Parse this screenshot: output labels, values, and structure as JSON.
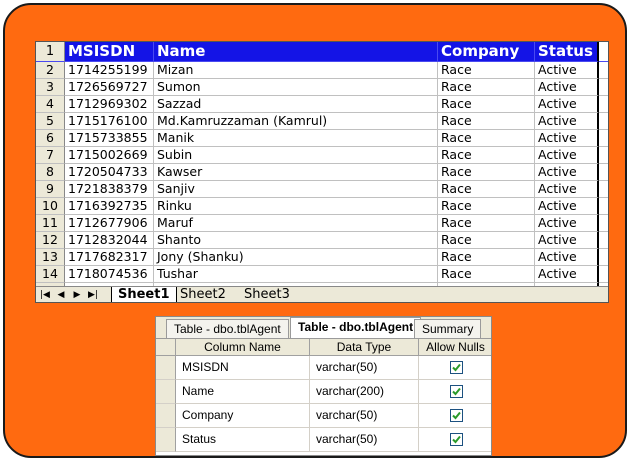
{
  "spreadsheet": {
    "columns": [
      "MSISDN",
      "Name",
      "Company",
      "Status"
    ],
    "header_row_number": "1",
    "rows": [
      {
        "num": "2",
        "msisdn": "1714255199",
        "name": "Mizan",
        "company": "Race",
        "status": "Active"
      },
      {
        "num": "3",
        "msisdn": "1726569727",
        "name": "Sumon",
        "company": "Race",
        "status": "Active"
      },
      {
        "num": "4",
        "msisdn": "1712969302",
        "name": "Sazzad",
        "company": "Race",
        "status": "Active"
      },
      {
        "num": "5",
        "msisdn": "1715176100",
        "name": "Md.Kamruzzaman (Kamrul)",
        "company": "Race",
        "status": "Active"
      },
      {
        "num": "6",
        "msisdn": "1715733855",
        "name": "Manik",
        "company": "Race",
        "status": "Active"
      },
      {
        "num": "7",
        "msisdn": "1715002669",
        "name": "Subin",
        "company": "Race",
        "status": "Active"
      },
      {
        "num": "8",
        "msisdn": "1720504733",
        "name": "Kawser",
        "company": "Race",
        "status": "Active"
      },
      {
        "num": "9",
        "msisdn": "1721838379",
        "name": "Sanjiv",
        "company": "Race",
        "status": "Active"
      },
      {
        "num": "10",
        "msisdn": "1716392735",
        "name": "Rinku",
        "company": "Race",
        "status": "Active"
      },
      {
        "num": "11",
        "msisdn": "1712677906",
        "name": "Maruf",
        "company": "Race",
        "status": "Active"
      },
      {
        "num": "12",
        "msisdn": "1712832044",
        "name": "Shanto",
        "company": "Race",
        "status": "Active"
      },
      {
        "num": "13",
        "msisdn": "1717682317",
        "name": "Jony (Shanku)",
        "company": "Race",
        "status": "Active"
      },
      {
        "num": "14",
        "msisdn": "1718074536",
        "name": "Tushar",
        "company": "Race",
        "status": "Active"
      }
    ],
    "sheet_tabs": [
      "Sheet1",
      "Sheet2",
      "Sheet3"
    ],
    "nav_buttons": [
      "first-icon",
      "prev-icon",
      "next-icon",
      "last-icon"
    ]
  },
  "designer": {
    "tabs": [
      "Table - dbo.tblAgent",
      "Table - dbo.tblAgent",
      "Summary"
    ],
    "active_tab_index": 1,
    "headers": [
      "Column Name",
      "Data Type",
      "Allow Nulls"
    ],
    "columns": [
      {
        "name": "MSISDN",
        "type": "varchar(50)",
        "allow_nulls": true
      },
      {
        "name": "Name",
        "type": "varchar(200)",
        "allow_nulls": true
      },
      {
        "name": "Company",
        "type": "varchar(50)",
        "allow_nulls": true
      },
      {
        "name": "Status",
        "type": "varchar(50)",
        "allow_nulls": true
      }
    ]
  },
  "colors": {
    "frame": "#ff6a10",
    "header_blue": "#1414e6",
    "check_green": "#2a9a2a"
  }
}
